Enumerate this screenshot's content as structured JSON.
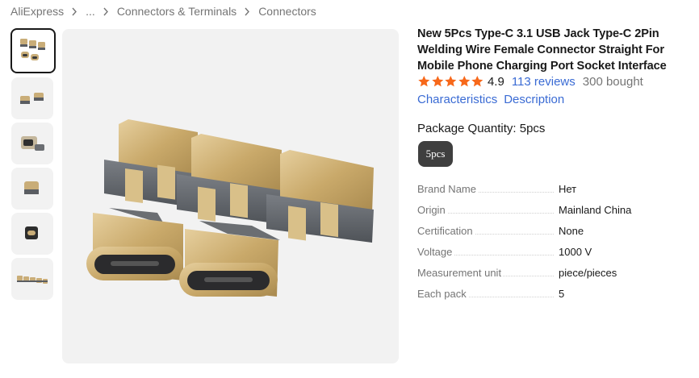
{
  "breadcrumb": {
    "items": [
      "AliExpress",
      "...",
      "Connectors & Terminals",
      "Connectors"
    ]
  },
  "product": {
    "title": "New 5Pcs Type-C 3.1 USB Jack Type-C 2Pin Welding Wire Female Connector Straight For Mobile Phone Charging Port Socket Interface",
    "rating": "4.9",
    "rating_stars": 5,
    "reviews": "113 reviews",
    "bought": "300 bought",
    "links": [
      "Characteristics",
      "Description"
    ],
    "star_color": "#f7681a",
    "link_color": "#3a6bd4"
  },
  "package": {
    "label": "Package Quantity: 5pcs",
    "selected_option": "5pcs"
  },
  "specs": [
    {
      "key": "Brand Name",
      "value": "Нет"
    },
    {
      "key": "Origin",
      "value": "Mainland China"
    },
    {
      "key": "Certification",
      "value": "None"
    },
    {
      "key": "Voltage",
      "value": "1000 V"
    },
    {
      "key": "Measurement unit",
      "value": "piece/pieces"
    },
    {
      "key": "Each pack",
      "value": "5"
    }
  ],
  "gallery": {
    "thumbnails": 6,
    "active_index": 0
  }
}
